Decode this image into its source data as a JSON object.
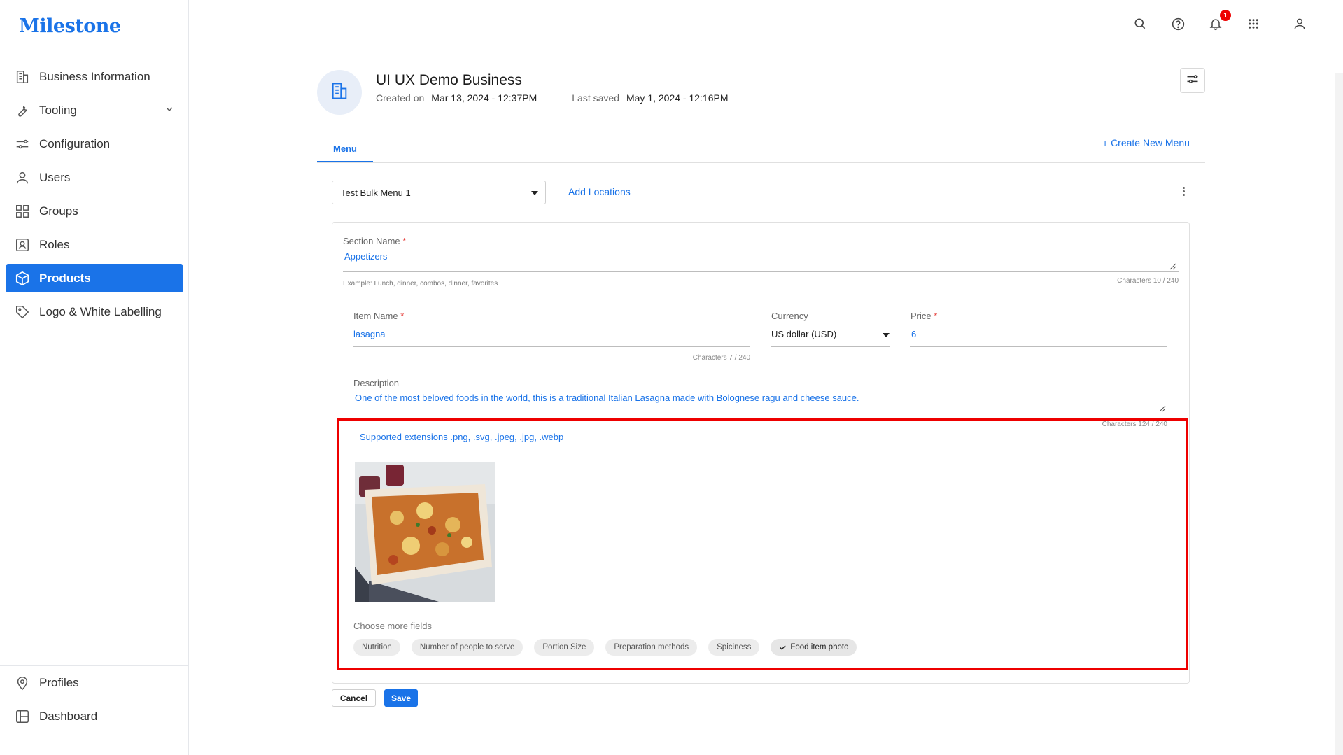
{
  "app": {
    "logo": "Milestone"
  },
  "sidebar": {
    "items": [
      {
        "label": "Business Information",
        "icon": "building-icon"
      },
      {
        "label": "Tooling",
        "icon": "wrench-icon"
      },
      {
        "label": "Configuration",
        "icon": "sliders-icon"
      },
      {
        "label": "Users",
        "icon": "user-icon"
      },
      {
        "label": "Groups",
        "icon": "grid-icon"
      },
      {
        "label": "Roles",
        "icon": "id-card-icon"
      },
      {
        "label": "Products",
        "icon": "cube-icon",
        "active": true
      },
      {
        "label": "Logo & White Labelling",
        "icon": "tag-icon"
      }
    ],
    "bottom_items": [
      {
        "label": "Profiles",
        "icon": "location-pin-icon"
      },
      {
        "label": "Dashboard",
        "icon": "dashboard-icon"
      }
    ]
  },
  "topbar": {
    "notification_count": "1"
  },
  "business": {
    "name": "UI UX Demo Business",
    "created_label": "Created on",
    "created_value": "Mar 13, 2024 - 12:37PM",
    "saved_label": "Last saved",
    "saved_value": "May 1, 2024 - 12:16PM"
  },
  "tabs": {
    "menu": "Menu",
    "create_new": "+ Create New Menu"
  },
  "menu_select": {
    "value": "Test Bulk Menu 1",
    "add_locations": "Add Locations"
  },
  "form": {
    "section_name": {
      "label": "Section Name",
      "value": "Appetizers",
      "hint": "Example: Lunch, dinner, combos, dinner, favorites",
      "counter": "Characters 10 / 240"
    },
    "item_name": {
      "label": "Item Name",
      "value": "lasagna",
      "counter": "Characters 7 / 240"
    },
    "currency": {
      "label": "Currency",
      "value": "US dollar (USD)"
    },
    "price": {
      "label": "Price",
      "value": "6"
    },
    "description": {
      "label": "Description",
      "value": "One of the most beloved foods in the world, this is a traditional Italian Lasagna made with Bolognese ragu and cheese sauce.",
      "counter": "Characters 124 / 240"
    },
    "supported_extensions": "Supported extensions .png, .svg, .jpeg, .jpg, .webp",
    "more_fields_label": "Choose more fields",
    "chips": [
      {
        "label": "Nutrition",
        "selected": false
      },
      {
        "label": "Number of people to serve",
        "selected": false
      },
      {
        "label": "Portion Size",
        "selected": false
      },
      {
        "label": "Preparation methods",
        "selected": false
      },
      {
        "label": "Spiciness",
        "selected": false
      },
      {
        "label": "Food item photo",
        "selected": true
      }
    ]
  },
  "actions": {
    "cancel": "Cancel",
    "save": "Save"
  },
  "colors": {
    "accent": "#1a73e8",
    "highlight": "#ee0000"
  }
}
